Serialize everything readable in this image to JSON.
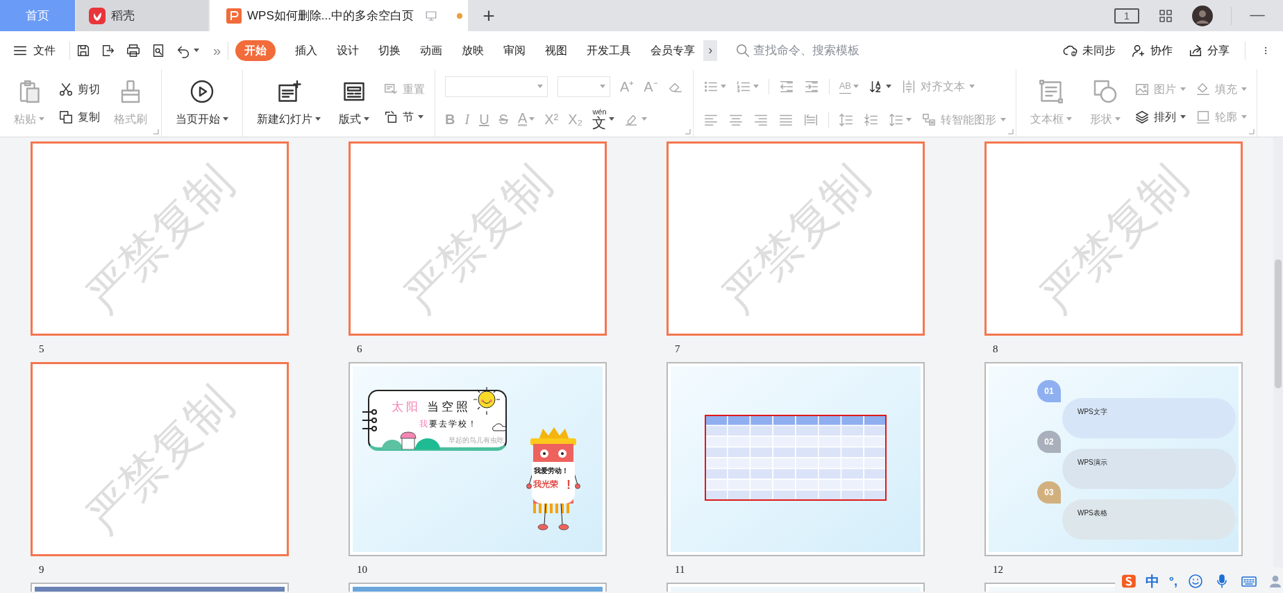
{
  "tabs": [
    {
      "label": "首页",
      "kind": "home",
      "selected": false
    },
    {
      "label": "稻壳",
      "kind": "docer",
      "selected": false
    },
    {
      "label": "WPS如何删除...中的多余空白页",
      "kind": "doc",
      "selected": true,
      "unsaved": true
    }
  ],
  "new_tab": "+",
  "page_indicator": "1",
  "menu": {
    "label": "文件"
  },
  "overflow": "»",
  "ribbon_tabs": [
    {
      "label": "开始",
      "selected": true
    },
    {
      "label": "插入",
      "selected": false
    },
    {
      "label": "设计",
      "selected": false
    },
    {
      "label": "切换",
      "selected": false
    },
    {
      "label": "动画",
      "selected": false
    },
    {
      "label": "放映",
      "selected": false
    },
    {
      "label": "审阅",
      "selected": false
    },
    {
      "label": "视图",
      "selected": false
    },
    {
      "label": "开发工具",
      "selected": false
    },
    {
      "label": "会员专享",
      "selected": false
    }
  ],
  "more_tabs": "›",
  "search": {
    "placeholder": "查找命令、搜索模板"
  },
  "actions": [
    {
      "label": "未同步"
    },
    {
      "label": "协作"
    },
    {
      "label": "分享"
    }
  ],
  "ribbon": [
    {
      "launcher": true,
      "items": [
        {
          "kind": "large",
          "label": "粘贴",
          "disabled": true,
          "dropdown": true
        },
        {
          "kind": "small",
          "label": "剪切",
          "disabled": false,
          "dropdown": false
        },
        {
          "kind": "small",
          "label": "复制",
          "disabled": false,
          "dropdown": false
        },
        {
          "kind": "large",
          "label": "格式刷",
          "disabled": true,
          "dropdown": false
        }
      ]
    },
    {
      "launcher": false,
      "items": [
        {
          "kind": "large",
          "label": "当页开始",
          "disabled": false,
          "dropdown": true
        }
      ]
    },
    {
      "launcher": false,
      "items": [
        {
          "kind": "large",
          "label": "新建幻灯片",
          "disabled": false,
          "dropdown": true
        },
        {
          "kind": "large",
          "label": "版式",
          "disabled": false,
          "dropdown": true
        },
        {
          "kind": "small",
          "label": "重置",
          "disabled": true,
          "dropdown": false
        },
        {
          "kind": "small",
          "label": "节",
          "disabled": false,
          "dropdown": true
        }
      ]
    },
    {
      "launcher": true,
      "items": [
        {
          "kind": "field"
        },
        {
          "kind": "field"
        },
        {
          "kind": "glyph",
          "label": "A⁺",
          "disabled": true,
          "dropdown": false
        },
        {
          "kind": "glyph",
          "label": "A⁻",
          "disabled": true,
          "dropdown": false
        },
        {
          "kind": "icon",
          "disabled": true,
          "dropdown": false
        },
        {
          "kind": "glyph",
          "label": "B",
          "disabled": true,
          "dropdown": false
        },
        {
          "kind": "glyph",
          "label": "I",
          "disabled": true,
          "dropdown": false
        },
        {
          "kind": "glyph",
          "label": "U",
          "disabled": true,
          "dropdown": false
        },
        {
          "kind": "glyph",
          "label": "S",
          "disabled": true,
          "dropdown": false
        },
        {
          "kind": "glyph",
          "label": "A",
          "disabled": true,
          "dropdown": true
        },
        {
          "kind": "glyph",
          "label": "X²",
          "disabled": true,
          "dropdown": false
        },
        {
          "kind": "glyph",
          "label": "X₂",
          "disabled": true,
          "dropdown": false
        },
        {
          "kind": "glyph",
          "label": "文",
          "pinyin": "wén",
          "disabled": false,
          "dropdown": true
        },
        {
          "kind": "icon",
          "disabled": true,
          "dropdown": true
        }
      ]
    },
    {
      "launcher": true,
      "items": [
        {
          "kind": "icon",
          "disabled": true,
          "dropdown": true
        },
        {
          "kind": "icon",
          "disabled": true,
          "dropdown": true
        },
        {
          "kind": "icon",
          "disabled": true,
          "dropdown": false
        },
        {
          "kind": "icon",
          "disabled": true,
          "dropdown": false
        },
        {
          "kind": "glyph",
          "label": "AB",
          "disabled": true,
          "dropdown": true
        },
        {
          "kind": "icon",
          "disabled": false,
          "dropdown": true
        },
        {
          "kind": "small",
          "label": "对齐文本",
          "disabled": true,
          "dropdown": true
        },
        {
          "kind": "icon",
          "disabled": true,
          "dropdown": false
        },
        {
          "kind": "icon",
          "disabled": true,
          "dropdown": false
        },
        {
          "kind": "icon",
          "disabled": true,
          "dropdown": false
        },
        {
          "kind": "icon",
          "disabled": true,
          "dropdown": false
        },
        {
          "kind": "icon",
          "disabled": true,
          "dropdown": false
        },
        {
          "kind": "icon",
          "disabled": true,
          "dropdown": false
        },
        {
          "kind": "icon",
          "disabled": true,
          "dropdown": false
        },
        {
          "kind": "icon",
          "disabled": true,
          "dropdown": true
        },
        {
          "kind": "small",
          "label": "转智能图形",
          "disabled": true,
          "dropdown": true
        }
      ]
    },
    {
      "launcher": true,
      "items": [
        {
          "kind": "large",
          "label": "文本框",
          "disabled": true,
          "dropdown": true
        },
        {
          "kind": "large",
          "label": "形状",
          "disabled": true,
          "dropdown": true
        },
        {
          "kind": "small",
          "label": "图片",
          "disabled": true,
          "dropdown": true
        },
        {
          "kind": "small",
          "label": "排列",
          "disabled": false,
          "dropdown": true
        },
        {
          "kind": "small",
          "label": "填充",
          "disabled": true,
          "dropdown": true
        },
        {
          "kind": "small",
          "label": "轮廓",
          "disabled": true,
          "dropdown": true
        }
      ]
    }
  ],
  "slides": [
    {
      "number": "5",
      "kind": "blank",
      "selected": true,
      "watermark": "严禁复制"
    },
    {
      "number": "6",
      "kind": "blank",
      "selected": true,
      "watermark": "严禁复制"
    },
    {
      "number": "7",
      "kind": "blank",
      "selected": true,
      "watermark": "严禁复制"
    },
    {
      "number": "8",
      "kind": "blank",
      "selected": true,
      "watermark": "严禁复制"
    },
    {
      "number": "9",
      "kind": "blank",
      "selected": true,
      "watermark": "严禁复制"
    },
    {
      "number": "10",
      "kind": "cartoon",
      "selected": false,
      "title_accent": "太阳",
      "title": "当空照",
      "subtitle_accent": "我",
      "subtitle": "要去学校！",
      "caption": "早起的鸟儿有虫吃",
      "sign_line1": "我爱劳动！",
      "sign_line2": "我光荣",
      "sign_mark": "!"
    },
    {
      "number": "11",
      "kind": "table",
      "selected": false
    },
    {
      "number": "12",
      "kind": "list",
      "selected": false,
      "items": [
        {
          "badge": "01",
          "label": "WPS文字",
          "color": "#8eb0f0"
        },
        {
          "badge": "02",
          "label": "WPS演示",
          "color": "#aab0bb"
        },
        {
          "badge": "03",
          "label": "WPS表格",
          "color": "#d2b07e"
        }
      ]
    },
    {
      "kind": "partial",
      "selected": false,
      "color": "#6a82b4"
    },
    {
      "kind": "partial",
      "selected": false,
      "color": "#6aa6dc"
    },
    {
      "kind": "partial",
      "selected": false,
      "color": "#eef7fc"
    },
    {
      "kind": "partial",
      "selected": false,
      "color": "#f3f8fb"
    }
  ],
  "ime": {
    "mode": "中",
    "punct": "°,"
  }
}
